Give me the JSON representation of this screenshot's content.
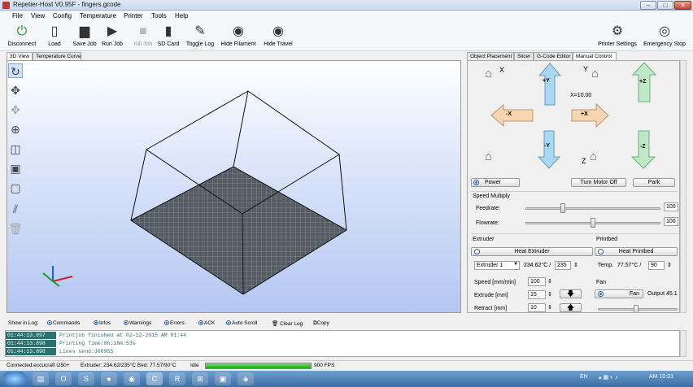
{
  "window": {
    "title": "Repetier-Host V0.95F - fingers.gcode",
    "min": "–",
    "max": "□",
    "close": "✕"
  },
  "menu": [
    "File",
    "View",
    "Config",
    "Temperature",
    "Printer",
    "Tools",
    "Help"
  ],
  "toolbar": {
    "disconnect": "Disconnect",
    "load": "Load",
    "save_job": "Save Job",
    "run_job": "Run Job",
    "kill_job": "Kill Job",
    "sd_card": "SD Card",
    "toggle_log": "Toggle Log",
    "hide_filament": "Hide Filament",
    "hide_travel": "Hide Travel",
    "printer_settings": "Printer Settings",
    "emergency_stop": "Emergency Stop"
  },
  "left_tabs": [
    "3D View",
    "Temperature Curve"
  ],
  "right_tabs": [
    "Object Placement",
    "Slicer",
    "G-Code Editor",
    "Manual Control"
  ],
  "manual": {
    "x_label": "X",
    "y_label": "Y",
    "z_label": "Z",
    "plus_y": "+Y",
    "minus_y": "-Y",
    "plus_x": "+X",
    "minus_x": "-X",
    "plus_z": "+Z",
    "minus_z": "-Z",
    "position": "X=10.00",
    "power": "Power",
    "turn_motor_off": "Turn Motor Off",
    "park": "Park",
    "speed_multiply": "Speed Multiply",
    "feedrate_label": "Feedrate:",
    "feedrate_value": "100",
    "feedrate_level": 0.28,
    "flowrate_label": "Flowrate:",
    "flowrate_value": "100",
    "flowrate_level": 0.5
  },
  "extruder": {
    "title": "Extruder",
    "heat": "Heat Extruder",
    "select": "Extruder 1",
    "temp": "234.62°C /",
    "target": "235",
    "speed_label": "Speed [mm/min]",
    "speed": "100",
    "extrude_label": "Extrude [mm]",
    "extrude": "15",
    "retract_label": "Retract [mm]",
    "retract": "10"
  },
  "printbed": {
    "title": "Printbed",
    "heat": "Heat Printbed",
    "temp_label": "Temp.",
    "temp": "77.57°C /",
    "target": "90",
    "fan_title": "Fan",
    "fan": "Fan",
    "fan_output": "Output 45.1"
  },
  "log_bar": {
    "show_in_log": "Show in Log:",
    "commands": "Commands",
    "infos": "Infos",
    "warnings": "Warnings",
    "errors": "Errors",
    "ack": "ACK",
    "auto_scroll": "Auto Scroll",
    "clear_log": "Clear Log",
    "copy": "Copy"
  },
  "log": [
    {
      "time": "01:44:13.897",
      "msg": "Printjob finished at 02-12-2015 AM 01:44"
    },
    {
      "time": "01:44:13.898",
      "msg": "Printing Time:8h:18m:53s"
    },
    {
      "time": "01:44:13.898",
      "msg": "Lines send:306955"
    }
  ],
  "status": {
    "connection": "Connected:eccucraft i250+",
    "extruder": "Extruder: 234.62/235°C Bed: 77.57/90°C",
    "state": "Idle",
    "progress": 1.0,
    "fps": "900 FPS"
  },
  "tray": {
    "lang": "EN",
    "time": "AM 10:31"
  },
  "colors": {
    "arrow_blue": "#a9d8f2",
    "arrow_orange": "#f6d5b0",
    "arrow_green": "#bfe8c6",
    "bed": "#555c63"
  }
}
